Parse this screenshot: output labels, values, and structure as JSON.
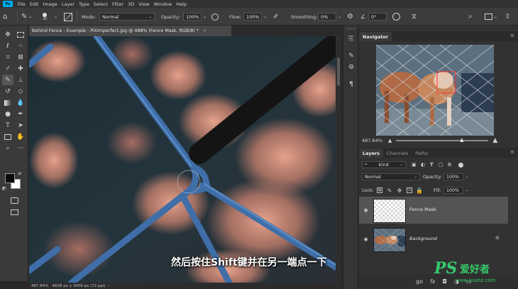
{
  "menubar": {
    "logo": "Ps",
    "items": [
      "File",
      "Edit",
      "Image",
      "Layer",
      "Type",
      "Select",
      "Filter",
      "3D",
      "View",
      "Window",
      "Help"
    ]
  },
  "options": {
    "brush_size": "30",
    "mode_label": "Mode:",
    "mode_value": "Normal",
    "opacity_label": "Opacity:",
    "opacity_value": "100%",
    "flow_label": "Flow:",
    "flow_value": "100%",
    "smoothing_label": "Smoothing:",
    "smoothing_value": "0%",
    "angle_value": "0°"
  },
  "document": {
    "tab_title": "Behind Fence - Example - PiXimperfect.jpg @ 488% (Fence Mask, RGB/8) *",
    "close": "×",
    "subtitle": "然后按住Shift键并在另一端点一下"
  },
  "status": {
    "zoom": "487.84%",
    "info": "4608 px x 3456 px (72 ppi)",
    "arrow": "›"
  },
  "navigator": {
    "tab": "Navigator",
    "zoom": "487.84%"
  },
  "layers_panel": {
    "tabs": [
      "Layers",
      "Channels",
      "Paths"
    ],
    "kind_label": "Kind",
    "blend_mode": "Normal",
    "opacity_label": "Opacity:",
    "opacity_value": "100%",
    "lock_label": "Lock:",
    "fill_label": "Fill:",
    "fill_value": "100%",
    "layers": [
      {
        "name": "Fence Mask"
      },
      {
        "name": "Background"
      }
    ]
  },
  "footer_icons": [
    "go",
    "fx"
  ],
  "watermark": {
    "logo": "PS",
    "name": "爱好者",
    "url": "www.psahz.com"
  },
  "colors": {
    "accent": "#36c96b",
    "fence": "#3f6ea8",
    "bokeh": "#e0907c"
  }
}
